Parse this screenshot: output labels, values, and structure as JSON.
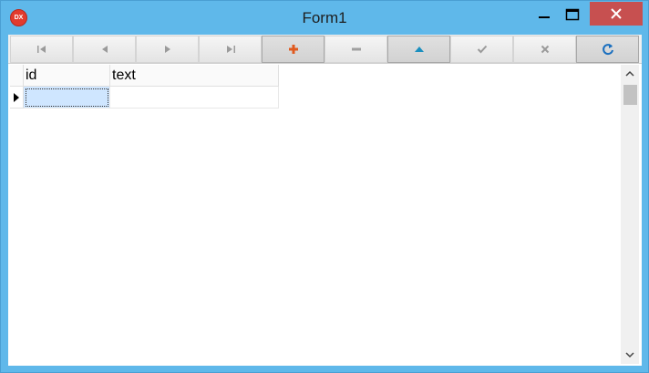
{
  "window": {
    "title": "Form1",
    "app_icon_text": "DX",
    "colors": {
      "frame": "#5fb8ea",
      "close": "#c75050",
      "selected_cell": "#cfe6ff"
    }
  },
  "navigator": {
    "buttons": [
      {
        "name": "first",
        "icon": "first-record-icon"
      },
      {
        "name": "prior",
        "icon": "prior-record-icon"
      },
      {
        "name": "next",
        "icon": "next-record-icon"
      },
      {
        "name": "last",
        "icon": "last-record-icon"
      },
      {
        "name": "insert",
        "icon": "insert-icon",
        "color": "#e05a1f"
      },
      {
        "name": "delete",
        "icon": "delete-icon"
      },
      {
        "name": "edit",
        "icon": "edit-icon",
        "color": "#1a8fbf"
      },
      {
        "name": "post",
        "icon": "post-check-icon"
      },
      {
        "name": "cancel",
        "icon": "cancel-icon"
      },
      {
        "name": "refresh",
        "icon": "refresh-icon",
        "color": "#1a6fbf"
      }
    ]
  },
  "grid": {
    "columns": [
      "id",
      "text"
    ],
    "rows": [
      {
        "id": "",
        "text": ""
      }
    ]
  }
}
